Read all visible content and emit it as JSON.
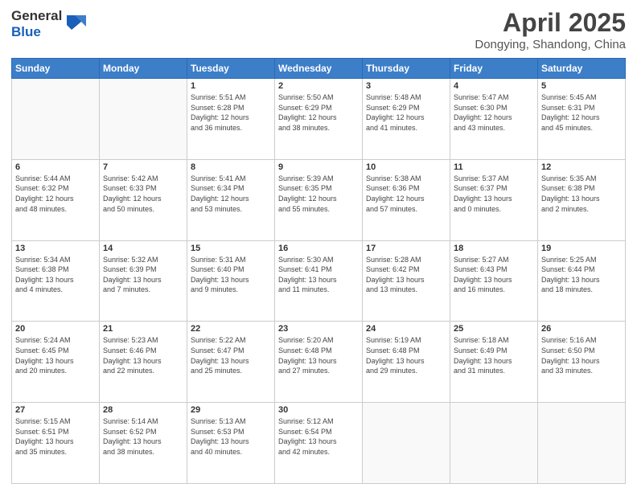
{
  "header": {
    "logo_general": "General",
    "logo_blue": "Blue",
    "month": "April 2025",
    "location": "Dongying, Shandong, China"
  },
  "weekdays": [
    "Sunday",
    "Monday",
    "Tuesday",
    "Wednesday",
    "Thursday",
    "Friday",
    "Saturday"
  ],
  "weeks": [
    [
      {
        "day": "",
        "info": ""
      },
      {
        "day": "",
        "info": ""
      },
      {
        "day": "1",
        "info": "Sunrise: 5:51 AM\nSunset: 6:28 PM\nDaylight: 12 hours\nand 36 minutes."
      },
      {
        "day": "2",
        "info": "Sunrise: 5:50 AM\nSunset: 6:29 PM\nDaylight: 12 hours\nand 38 minutes."
      },
      {
        "day": "3",
        "info": "Sunrise: 5:48 AM\nSunset: 6:29 PM\nDaylight: 12 hours\nand 41 minutes."
      },
      {
        "day": "4",
        "info": "Sunrise: 5:47 AM\nSunset: 6:30 PM\nDaylight: 12 hours\nand 43 minutes."
      },
      {
        "day": "5",
        "info": "Sunrise: 5:45 AM\nSunset: 6:31 PM\nDaylight: 12 hours\nand 45 minutes."
      }
    ],
    [
      {
        "day": "6",
        "info": "Sunrise: 5:44 AM\nSunset: 6:32 PM\nDaylight: 12 hours\nand 48 minutes."
      },
      {
        "day": "7",
        "info": "Sunrise: 5:42 AM\nSunset: 6:33 PM\nDaylight: 12 hours\nand 50 minutes."
      },
      {
        "day": "8",
        "info": "Sunrise: 5:41 AM\nSunset: 6:34 PM\nDaylight: 12 hours\nand 53 minutes."
      },
      {
        "day": "9",
        "info": "Sunrise: 5:39 AM\nSunset: 6:35 PM\nDaylight: 12 hours\nand 55 minutes."
      },
      {
        "day": "10",
        "info": "Sunrise: 5:38 AM\nSunset: 6:36 PM\nDaylight: 12 hours\nand 57 minutes."
      },
      {
        "day": "11",
        "info": "Sunrise: 5:37 AM\nSunset: 6:37 PM\nDaylight: 13 hours\nand 0 minutes."
      },
      {
        "day": "12",
        "info": "Sunrise: 5:35 AM\nSunset: 6:38 PM\nDaylight: 13 hours\nand 2 minutes."
      }
    ],
    [
      {
        "day": "13",
        "info": "Sunrise: 5:34 AM\nSunset: 6:38 PM\nDaylight: 13 hours\nand 4 minutes."
      },
      {
        "day": "14",
        "info": "Sunrise: 5:32 AM\nSunset: 6:39 PM\nDaylight: 13 hours\nand 7 minutes."
      },
      {
        "day": "15",
        "info": "Sunrise: 5:31 AM\nSunset: 6:40 PM\nDaylight: 13 hours\nand 9 minutes."
      },
      {
        "day": "16",
        "info": "Sunrise: 5:30 AM\nSunset: 6:41 PM\nDaylight: 13 hours\nand 11 minutes."
      },
      {
        "day": "17",
        "info": "Sunrise: 5:28 AM\nSunset: 6:42 PM\nDaylight: 13 hours\nand 13 minutes."
      },
      {
        "day": "18",
        "info": "Sunrise: 5:27 AM\nSunset: 6:43 PM\nDaylight: 13 hours\nand 16 minutes."
      },
      {
        "day": "19",
        "info": "Sunrise: 5:25 AM\nSunset: 6:44 PM\nDaylight: 13 hours\nand 18 minutes."
      }
    ],
    [
      {
        "day": "20",
        "info": "Sunrise: 5:24 AM\nSunset: 6:45 PM\nDaylight: 13 hours\nand 20 minutes."
      },
      {
        "day": "21",
        "info": "Sunrise: 5:23 AM\nSunset: 6:46 PM\nDaylight: 13 hours\nand 22 minutes."
      },
      {
        "day": "22",
        "info": "Sunrise: 5:22 AM\nSunset: 6:47 PM\nDaylight: 13 hours\nand 25 minutes."
      },
      {
        "day": "23",
        "info": "Sunrise: 5:20 AM\nSunset: 6:48 PM\nDaylight: 13 hours\nand 27 minutes."
      },
      {
        "day": "24",
        "info": "Sunrise: 5:19 AM\nSunset: 6:48 PM\nDaylight: 13 hours\nand 29 minutes."
      },
      {
        "day": "25",
        "info": "Sunrise: 5:18 AM\nSunset: 6:49 PM\nDaylight: 13 hours\nand 31 minutes."
      },
      {
        "day": "26",
        "info": "Sunrise: 5:16 AM\nSunset: 6:50 PM\nDaylight: 13 hours\nand 33 minutes."
      }
    ],
    [
      {
        "day": "27",
        "info": "Sunrise: 5:15 AM\nSunset: 6:51 PM\nDaylight: 13 hours\nand 35 minutes."
      },
      {
        "day": "28",
        "info": "Sunrise: 5:14 AM\nSunset: 6:52 PM\nDaylight: 13 hours\nand 38 minutes."
      },
      {
        "day": "29",
        "info": "Sunrise: 5:13 AM\nSunset: 6:53 PM\nDaylight: 13 hours\nand 40 minutes."
      },
      {
        "day": "30",
        "info": "Sunrise: 5:12 AM\nSunset: 6:54 PM\nDaylight: 13 hours\nand 42 minutes."
      },
      {
        "day": "",
        "info": ""
      },
      {
        "day": "",
        "info": ""
      },
      {
        "day": "",
        "info": ""
      }
    ]
  ]
}
